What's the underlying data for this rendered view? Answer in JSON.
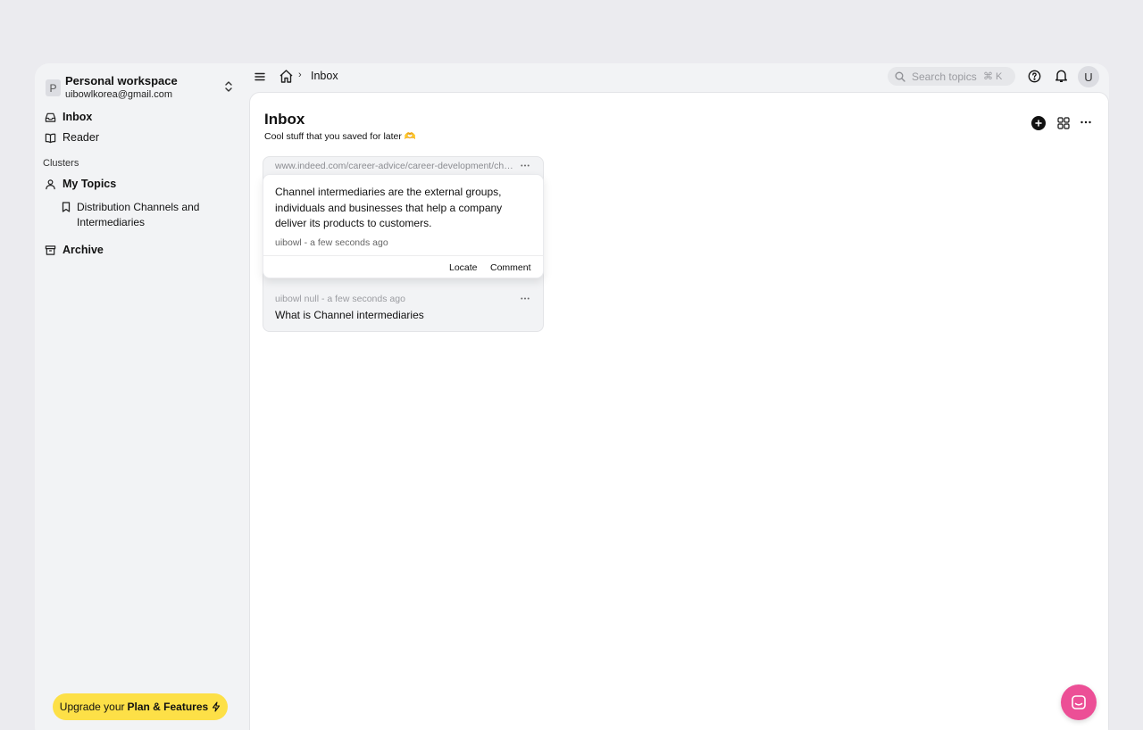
{
  "workspace": {
    "initial": "P",
    "name": "Personal workspace",
    "email": "uibowlkorea@gmail.com"
  },
  "sidebar": {
    "items": [
      {
        "label": "Inbox",
        "icon": "inbox-icon"
      },
      {
        "label": "Reader",
        "icon": "book-open-icon"
      }
    ],
    "clusters_label": "Clusters",
    "my_topics": {
      "label": "My Topics",
      "icon": "user-icon"
    },
    "topic": {
      "label": "Distribution Channels and Intermediaries",
      "icon": "bookmark-icon"
    },
    "archive": {
      "label": "Archive",
      "icon": "archive-icon"
    },
    "upgrade": {
      "prefix": "Upgrade your",
      "bold": "Plan & Features",
      "icon": "bolt-icon"
    }
  },
  "topbar": {
    "breadcrumb_sep": "›",
    "current": "Inbox",
    "search_placeholder": "Search topics",
    "search_shortcut": "⌘ K",
    "user_initial": "U"
  },
  "main": {
    "title": "Inbox",
    "subtitle": "Cool stuff that you saved for later 🫶",
    "card": {
      "url": "www.indeed.com/career-advice/career-development/channel-intermediaries",
      "quote": "Channel intermediaries are the external groups, individuals and businesses that help a company deliver its products to customers.",
      "quote_meta": "uibowl - a few seconds ago",
      "locate_label": "Locate",
      "comment_label": "Comment",
      "note_meta": "uibowl null  -  a few seconds ago",
      "note_text": "What is Channel intermediaries"
    }
  },
  "colors": {
    "upgrade_bg": "#fde047",
    "chat_fab": "#ec4f96",
    "app_bg": "#f2f3f5"
  }
}
